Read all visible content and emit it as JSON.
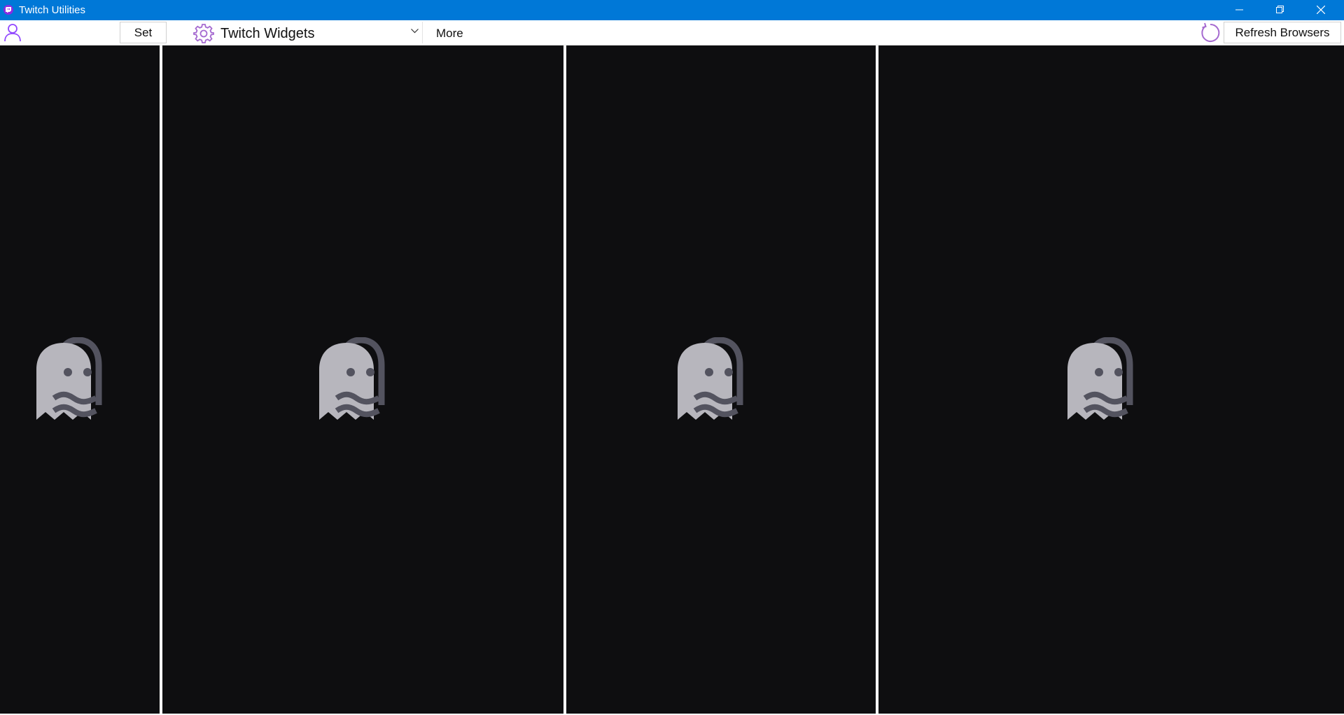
{
  "window": {
    "title": "Twitch Utilities",
    "icon": "twitch-logo-icon",
    "controls": [
      "minimize-icon",
      "restore-icon",
      "close-icon"
    ]
  },
  "toolbar": {
    "user_icon": "user-icon",
    "username_value": "",
    "set_label": "Set",
    "widgets_icon": "gear-icon",
    "widgets_selected": "Twitch Widgets",
    "more_label": "More",
    "refresh_icon": "refresh-icon",
    "refresh_label": "Refresh Browsers"
  },
  "panels": [
    {
      "placeholder_icon": "ghost-icon"
    },
    {
      "placeholder_icon": "ghost-icon"
    },
    {
      "placeholder_icon": "ghost-icon"
    },
    {
      "placeholder_icon": "ghost-icon"
    }
  ],
  "colors": {
    "titlebar": "#0078d7",
    "accent": "#9147ff",
    "panel_bg": "#0e0e10",
    "ghost_body": "#b7b6bd",
    "ghost_outline": "#53535f"
  }
}
